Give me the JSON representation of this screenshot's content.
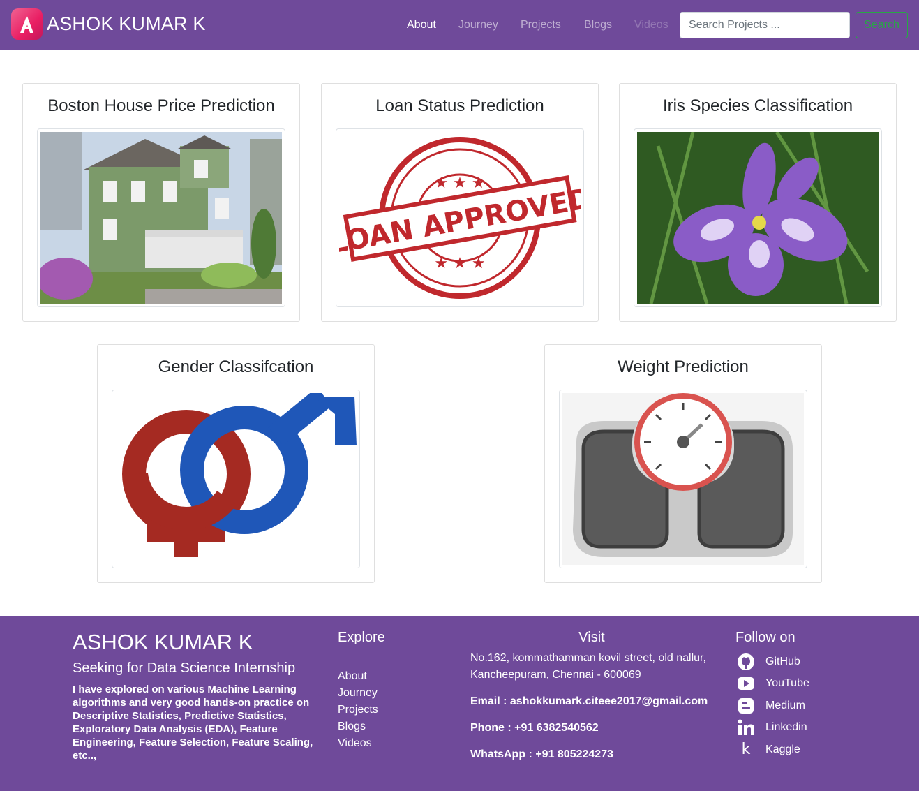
{
  "navbar": {
    "brand_letter": "A",
    "brand_name": "ASHOK KUMAR K",
    "links": [
      "About",
      "Journey",
      "Projects",
      "Blogs",
      "Videos"
    ],
    "search_placeholder": "Search Projects ...",
    "search_label": "Search"
  },
  "projects": [
    {
      "title": "Boston House Price Prediction",
      "image": "house-photo"
    },
    {
      "title": "Loan Status Prediction",
      "image": "loan-approved-stamp",
      "stamp_text": "LOAN APPROVED"
    },
    {
      "title": "Iris Species Classification",
      "image": "iris-flower-photo"
    },
    {
      "title": "Gender Classifcation",
      "image": "gender-symbols"
    },
    {
      "title": "Weight Prediction",
      "image": "weighing-scale"
    }
  ],
  "footer": {
    "name": "ASHOK KUMAR K",
    "tagline": "Seeking for Data Science Internship",
    "description": "I have explored on various Machine Learning algorithms and very good hands-on practice on Descriptive Statistics, Predictive Statistics, Exploratory Data Analysis (EDA), Feature Engineering, Feature Selection, Feature Scaling, etc..,",
    "explore_heading": "Explore",
    "explore_links": [
      "About",
      "Journey",
      "Projects",
      "Blogs",
      "Videos"
    ],
    "visit_heading": "Visit",
    "address": "No.162, kommathamman kovil street, old nallur, Kancheepuram, Chennai - 600069",
    "email": "Email : ashokkumark.citeee2017@gmail.com",
    "phone": "Phone : +91 6382540562",
    "whatsapp": "WhatsApp : +91 805224273",
    "follow_heading": "Follow on",
    "social": [
      {
        "label": "GitHub",
        "icon": "github-icon"
      },
      {
        "label": "YouTube",
        "icon": "youtube-icon"
      },
      {
        "label": "Medium",
        "icon": "blogger-icon"
      },
      {
        "label": "Linkedin",
        "icon": "linkedin-icon"
      },
      {
        "label": "Kaggle",
        "icon": "kaggle-icon"
      }
    ]
  },
  "colors": {
    "brand_purple": "#6f4a9a",
    "search_green": "#28a745",
    "logo_pink": "#e91e63"
  }
}
